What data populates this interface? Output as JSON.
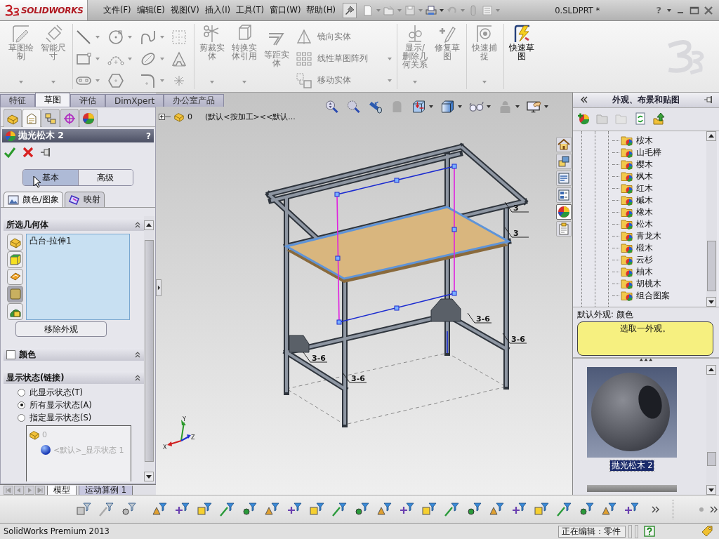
{
  "title_bar": {
    "logo": "SOLIDWORKS",
    "menu": [
      "文件(F)",
      "编辑(E)",
      "视图(V)",
      "插入(I)",
      "工具(T)",
      "窗口(W)",
      "帮助(H)"
    ],
    "document": "0.SLDPRT *",
    "help": "?"
  },
  "ribbon": {
    "sketch": {
      "label": "草图绘制",
      "disabled": true
    },
    "smart_dimension": {
      "label": "智能尺寸",
      "disabled": true
    },
    "trim": {
      "label": "剪裁实体",
      "disabled": true
    },
    "convert": {
      "label": "转换实体引用",
      "disabled": true
    },
    "offset": {
      "label": "等距实体",
      "disabled": true
    },
    "mirror": {
      "label": "镜向实体",
      "disabled": true
    },
    "pattern": {
      "label": "线性草图阵列",
      "disabled": true
    },
    "move": {
      "label": "移动实体",
      "disabled": true
    },
    "relations": {
      "label": "显示/删除几何关系",
      "disabled": true
    },
    "repair": {
      "label": "修复草图",
      "disabled": true
    },
    "quick_snaps": {
      "label": "快速捕捉",
      "disabled": true
    },
    "rapid_sketch": {
      "label": "快速草图",
      "disabled": false
    }
  },
  "command_tabs": [
    {
      "label": "特征",
      "selected": false
    },
    {
      "label": "草图",
      "selected": true
    },
    {
      "label": "评估",
      "selected": false
    },
    {
      "label": "DimXpert",
      "selected": false
    },
    {
      "label": "办公室产品",
      "selected": false
    }
  ],
  "property_manager": {
    "tabs": [
      {
        "kind": "feature_tree",
        "selected": false
      },
      {
        "kind": "property",
        "selected": true
      },
      {
        "kind": "configuration",
        "selected": false
      },
      {
        "kind": "dimxpert",
        "selected": false
      },
      {
        "kind": "display",
        "selected": false
      }
    ],
    "title": "抛光松木 2",
    "help": "?",
    "modes": [
      {
        "label": "基本",
        "selected": true
      },
      {
        "label": "高级",
        "selected": false
      }
    ],
    "subtabs": [
      {
        "kind": "color_image",
        "label": "颜色/图象",
        "selected": true
      },
      {
        "kind": "mapping",
        "label": "映射",
        "selected": false
      }
    ],
    "geometry": {
      "title": "所选几何体",
      "filters": [
        {
          "kind": "part",
          "selected": false
        },
        {
          "kind": "body",
          "selected": false
        },
        {
          "kind": "feature",
          "selected": false
        },
        {
          "kind": "face",
          "selected": true
        },
        {
          "kind": "surface",
          "selected": false
        }
      ],
      "items": [
        "凸台-拉伸1"
      ],
      "remove_button": "移除外观"
    },
    "color": {
      "title": "颜色",
      "checked": false
    },
    "display_states": {
      "title": "显示状态(链接)",
      "options": [
        {
          "label": "此显示状态(T)",
          "selected": false
        },
        {
          "label": "所有显示状态(A)",
          "selected": true
        },
        {
          "label": "指定显示状态(S)",
          "selected": false
        }
      ],
      "tree": {
        "label": "0",
        "disabled": true,
        "children": [
          {
            "label": "<默认>_显示状态 1"
          }
        ]
      }
    }
  },
  "bottom_tabs": [
    {
      "label": "模型",
      "selected": true
    },
    {
      "label": "运动算例 1",
      "selected": false
    }
  ],
  "viewport": {
    "flyout": {
      "part": "0",
      "configuration": "(默认<按加工><<默认..."
    },
    "weld_labels": [
      "3",
      "3",
      "3-6",
      "3-6",
      "3-6",
      "3-6"
    ],
    "axes": [
      "Y",
      "X",
      "Z"
    ]
  },
  "task_tabs": [
    {
      "kind": "home",
      "selected": false
    },
    {
      "kind": "content",
      "selected": false
    },
    {
      "kind": "library",
      "selected": false
    },
    {
      "kind": "explorer",
      "selected": false
    },
    {
      "kind": "appearance",
      "selected": true
    },
    {
      "kind": "properties",
      "selected": false
    }
  ],
  "task_pane": {
    "title": "外观、布景和贴图",
    "materials": [
      "桉木",
      "山毛榉",
      "樱木",
      "枫木",
      "红木",
      "槭木",
      "橡木",
      "松木",
      "青龙木",
      "椴木",
      "云杉",
      "柚木",
      "胡桃木",
      "组合图案"
    ],
    "default_label": "默认外观: 颜色",
    "message": "选取一外观。",
    "preview": {
      "caption": "抛光松木 2",
      "selected": true
    }
  },
  "status_bar": {
    "product": "SolidWorks Premium 2013",
    "mode": "正在编辑：零件"
  }
}
